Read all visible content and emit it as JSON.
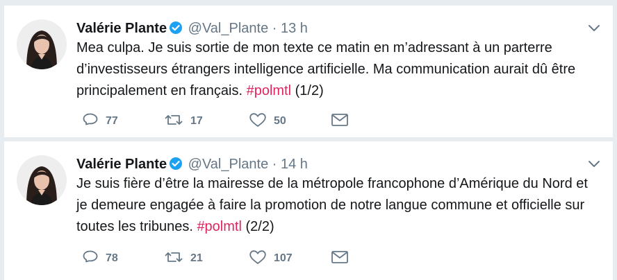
{
  "tweets": [
    {
      "author_name": "Valérie Plante",
      "handle": "@Val_Plante",
      "separator": "·",
      "time": "13 h",
      "text_main": "Mea culpa. Je suis sortie de mon texte ce matin en m’adressant à un parterre d’investisseurs étrangers intelligence artificielle. Ma communication aurait dû être principalement en français.",
      "hashtag": "#polmtl",
      "suffix": "(1/2)",
      "replies": "77",
      "retweets": "17",
      "likes": "50"
    },
    {
      "author_name": "Valérie Plante",
      "handle": "@Val_Plante",
      "separator": "·",
      "time": "14 h",
      "text_main": "Je suis fière d’être la mairesse de la métropole francophone d’Amérique du Nord et je demeure engagée à faire la promotion de notre langue commune et officielle sur toutes les tribunes.",
      "hashtag": "#polmtl",
      "suffix": "(2/2)",
      "replies": "78",
      "retweets": "21",
      "likes": "107"
    }
  ],
  "icons": {
    "verified": "verified-badge-icon",
    "caret": "chevron-down-icon",
    "reply": "reply-icon",
    "retweet": "retweet-icon",
    "like": "heart-icon",
    "dm": "envelope-icon"
  },
  "colors": {
    "background": "#e6ecf0",
    "text": "#14171a",
    "meta": "#657786",
    "hashtag": "#e0245e",
    "verified": "#1da1f2"
  }
}
